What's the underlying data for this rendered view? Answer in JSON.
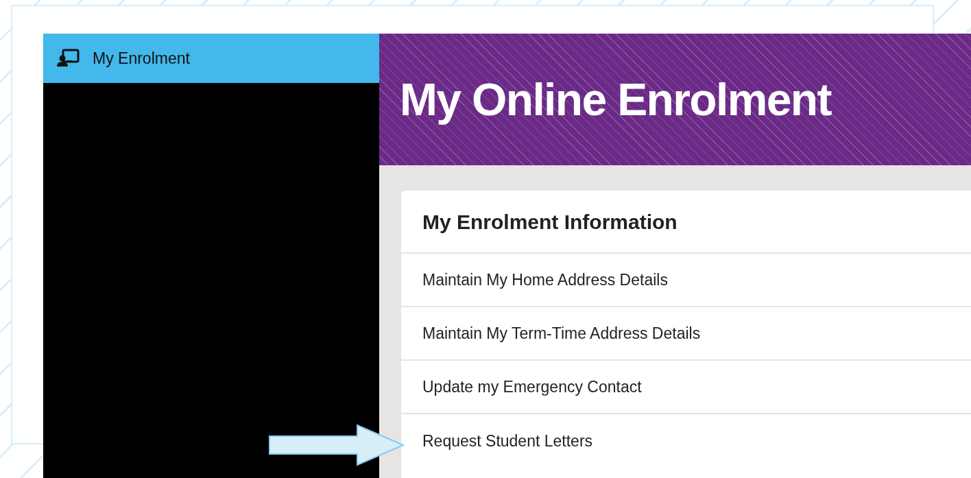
{
  "sidebar": {
    "header": "My Enrolment"
  },
  "banner": {
    "title": "My Online Enrolment"
  },
  "card": {
    "title": "My Enrolment Information",
    "items": [
      {
        "label": "Maintain My Home Address Details"
      },
      {
        "label": "Maintain My Term-Time Address Details"
      },
      {
        "label": "Update my Emergency Contact"
      },
      {
        "label": "Request Student Letters"
      }
    ]
  }
}
